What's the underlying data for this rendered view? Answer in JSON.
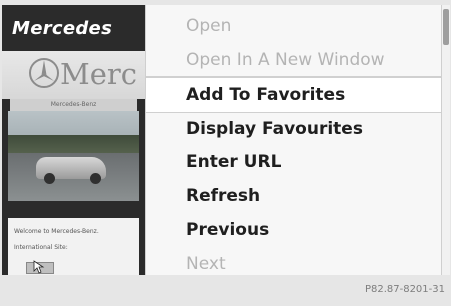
{
  "browser": {
    "brand_title": "Mercedes",
    "logo_text": "Merc",
    "site_strip": "Mercedes-Benz",
    "welcome_text": "Welcome to Mercedes-Benz.",
    "international_text": "International Site:"
  },
  "menu": {
    "items": [
      {
        "label": "Open",
        "enabled": false
      },
      {
        "label": "Open In A New Window",
        "enabled": false
      },
      {
        "label": "Add To Favorites",
        "enabled": true,
        "selected": true
      },
      {
        "label": "Display Favourites",
        "enabled": true
      },
      {
        "label": "Enter URL",
        "enabled": true
      },
      {
        "label": "Refresh",
        "enabled": true
      },
      {
        "label": "Previous",
        "enabled": true
      },
      {
        "label": "Next",
        "enabled": false
      }
    ]
  },
  "footer": {
    "code": "P82.87-8201-31"
  }
}
